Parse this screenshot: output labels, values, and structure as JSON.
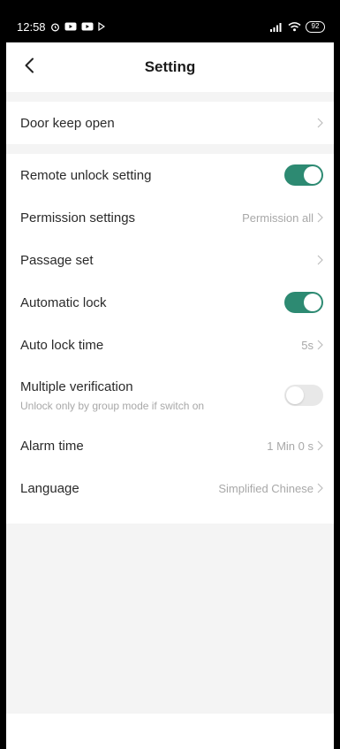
{
  "status_bar": {
    "time": "12:58",
    "battery": "92"
  },
  "header": {
    "title": "Setting"
  },
  "rows": {
    "door_keep_open": {
      "label": "Door keep open",
      "value": ""
    },
    "remote_unlock": {
      "label": "Remote unlock setting",
      "toggle": true
    },
    "permission": {
      "label": "Permission settings",
      "value": "Permission all"
    },
    "passage": {
      "label": "Passage set",
      "value": ""
    },
    "automatic_lock": {
      "label": "Automatic lock",
      "toggle": true
    },
    "auto_lock_time": {
      "label": "Auto lock time",
      "value": "5s"
    },
    "multiple_verification": {
      "label": "Multiple verification",
      "sub": "Unlock only by group mode if switch on",
      "toggle": false
    },
    "alarm_time": {
      "label": "Alarm time",
      "value": "1 Min 0 s"
    },
    "language": {
      "label": "Language",
      "value": "Simplified Chinese"
    }
  },
  "colors": {
    "accent": "#2d8a72",
    "toggle_off": "#e8e8e8",
    "page_bg": "#f4f4f4",
    "secondary_text": "#a8a8a8"
  },
  "icons": {
    "back": "chevron-left-icon",
    "chevron": "chevron-right-icon",
    "alarm": "alarm-clock-icon",
    "signal": "signal-icon",
    "wifi": "wifi-icon",
    "battery": "battery-icon"
  }
}
